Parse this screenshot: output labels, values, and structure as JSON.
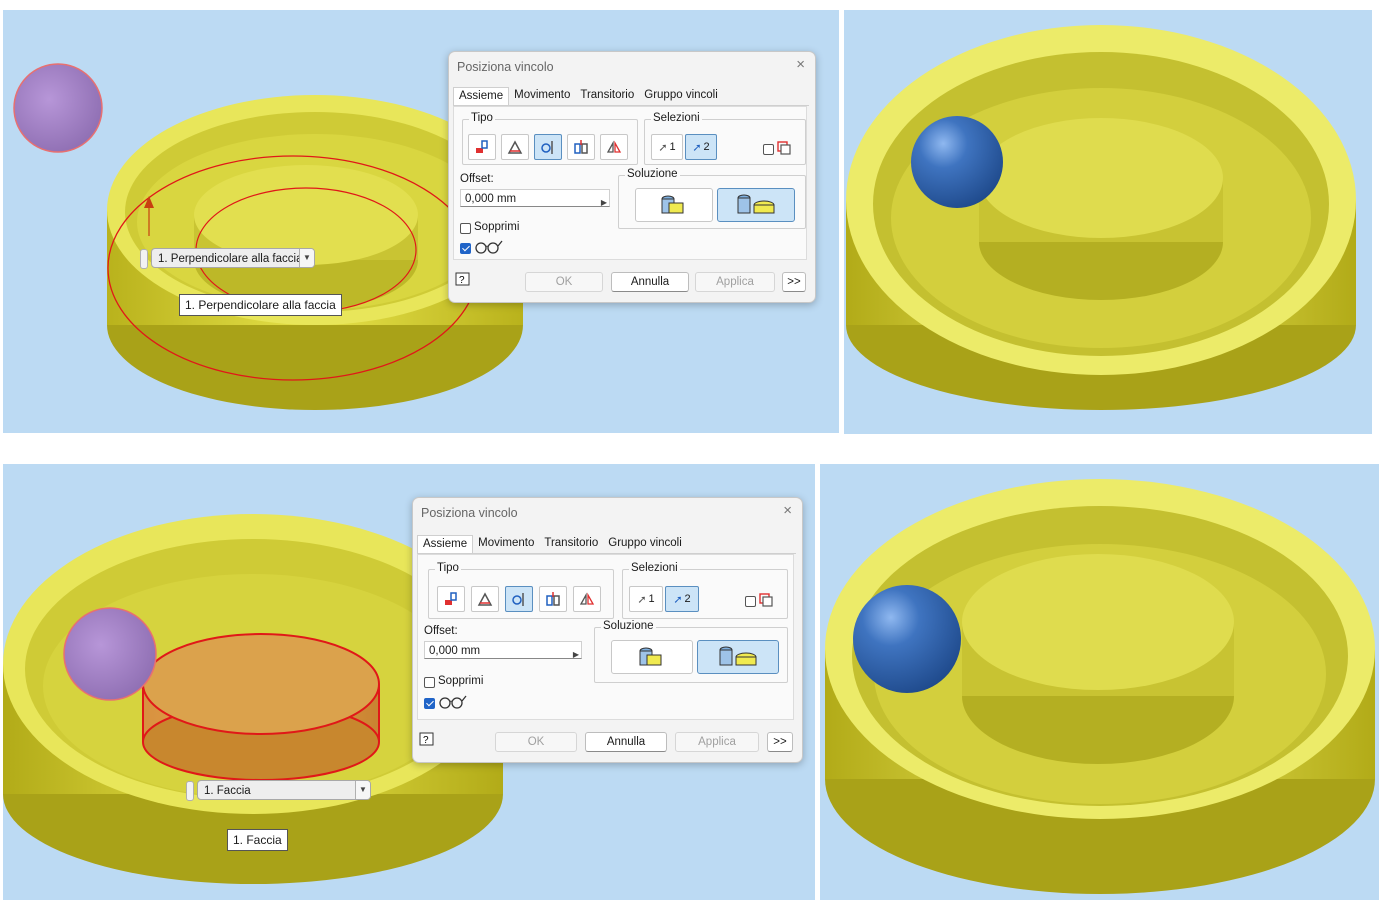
{
  "dialog": {
    "title": "Posiziona vincolo",
    "close_glyph": "×",
    "tabs": [
      "Assieme",
      "Movimento",
      "Transitorio",
      "Gruppo vincoli"
    ],
    "active_tab": "Assieme",
    "tipo_label": "Tipo",
    "tipo_icons": [
      "mate-icon",
      "angle-icon",
      "tangent-icon",
      "insert-icon",
      "symmetry-icon"
    ],
    "tipo_selected": "tangent-icon",
    "selezioni_label": "Selezioni",
    "sel1_label": "1",
    "sel2_label": "2",
    "offset_label": "Offset:",
    "offset_value": "0,000 mm",
    "soluzione_label": "Soluzione",
    "sopprimi_label": "Sopprimi",
    "sopprimi_checked": false,
    "preview_checked": true,
    "ok_label": "OK",
    "annulla_label": "Annulla",
    "applica_label": "Applica",
    "more_label": ">>"
  },
  "step1": {
    "selection_combo": "1. Perpendicolare alla faccia",
    "tooltip": "1. Perpendicolare alla faccia"
  },
  "step2": {
    "selection_combo": "1. Faccia",
    "tooltip": "1. Faccia"
  },
  "colors": {
    "viewport": "#bcdaf3",
    "part_yellow": "#d9d93a",
    "ball_transparent": "#a07cc0",
    "ball_blue": "#3f74c0",
    "highlight_red": "#e01818",
    "accent": "#2064c8"
  }
}
